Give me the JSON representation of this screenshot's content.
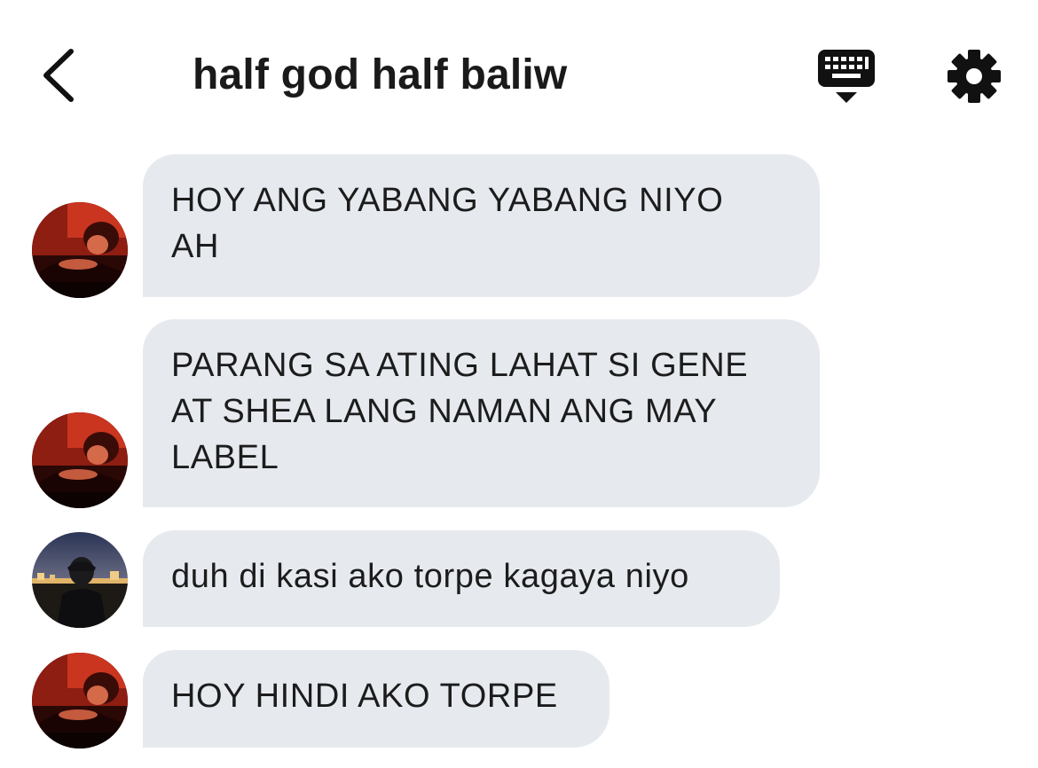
{
  "header": {
    "title": "half god half baliw",
    "back_icon": "chevron-left-icon",
    "keyboard_icon": "keyboard-icon",
    "settings_icon": "gear-icon"
  },
  "messages": [
    {
      "text": "HOY ANG YABANG YABANG NIYO\nAH",
      "avatar": "avatar-red-room"
    },
    {
      "text": "PARANG SA ATING LAHAT SI GENE\nAT SHEA LANG NAMAN ANG MAY\nLABEL",
      "avatar": "avatar-red-room"
    },
    {
      "text": "duh di kasi ako torpe kagaya niyo",
      "avatar": "avatar-city-night"
    },
    {
      "text": "HOY HINDI AKO TORPE",
      "avatar": "avatar-red-room"
    }
  ],
  "colors": {
    "bubble": "#e6eaef",
    "text": "#1c1c1c",
    "icon": "#111111"
  }
}
